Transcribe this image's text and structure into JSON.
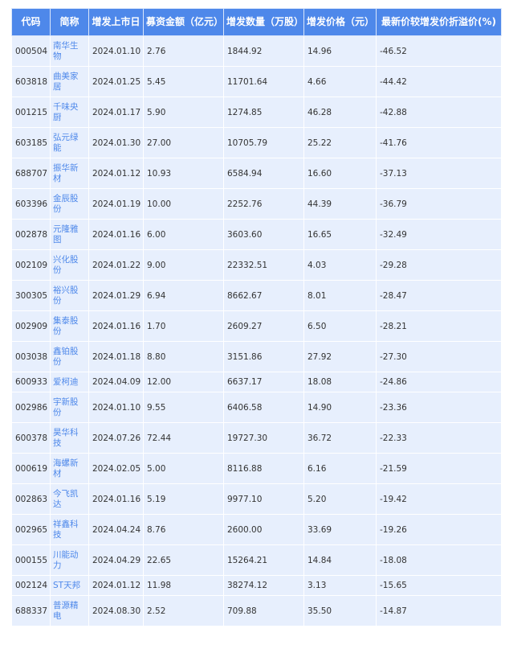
{
  "table": {
    "headers": [
      "代码",
      "简称",
      "增发上市日",
      "募资金额（亿元）",
      "增发数量（万股）",
      "增发价格（元）",
      "最新价较增发价折溢价(%)"
    ],
    "rows": [
      {
        "code": "000504",
        "name": "南华生物",
        "date": "2024.01.10",
        "amount": "2.76",
        "shares": "1844.92",
        "price": "14.96",
        "premium": "-46.52"
      },
      {
        "code": "603818",
        "name": "曲美家居",
        "date": "2024.01.25",
        "amount": "5.45",
        "shares": "11701.64",
        "price": "4.66",
        "premium": "-44.42"
      },
      {
        "code": "001215",
        "name": "千味央厨",
        "date": "2024.01.17",
        "amount": "5.90",
        "shares": "1274.85",
        "price": "46.28",
        "premium": "-42.88"
      },
      {
        "code": "603185",
        "name": "弘元绿能",
        "date": "2024.01.30",
        "amount": "27.00",
        "shares": "10705.79",
        "price": "25.22",
        "premium": "-41.76"
      },
      {
        "code": "688707",
        "name": "振华新材",
        "date": "2024.01.12",
        "amount": "10.93",
        "shares": "6584.94",
        "price": "16.60",
        "premium": "-37.13"
      },
      {
        "code": "603396",
        "name": "金辰股份",
        "date": "2024.01.19",
        "amount": "10.00",
        "shares": "2252.76",
        "price": "44.39",
        "premium": "-36.79"
      },
      {
        "code": "002878",
        "name": "元隆雅图",
        "date": "2024.01.16",
        "amount": "6.00",
        "shares": "3603.60",
        "price": "16.65",
        "premium": "-32.49"
      },
      {
        "code": "002109",
        "name": "兴化股份",
        "date": "2024.01.22",
        "amount": "9.00",
        "shares": "22332.51",
        "price": "4.03",
        "premium": "-29.28"
      },
      {
        "code": "300305",
        "name": "裕兴股份",
        "date": "2024.01.29",
        "amount": "6.94",
        "shares": "8662.67",
        "price": "8.01",
        "premium": "-28.47"
      },
      {
        "code": "002909",
        "name": "集泰股份",
        "date": "2024.01.16",
        "amount": "1.70",
        "shares": "2609.27",
        "price": "6.50",
        "premium": "-28.21"
      },
      {
        "code": "003038",
        "name": "鑫铂股份",
        "date": "2024.01.18",
        "amount": "8.80",
        "shares": "3151.86",
        "price": "27.92",
        "premium": "-27.30"
      },
      {
        "code": "600933",
        "name": "爱柯迪",
        "date": "2024.04.09",
        "amount": "12.00",
        "shares": "6637.17",
        "price": "18.08",
        "premium": "-24.86"
      },
      {
        "code": "002986",
        "name": "宇新股份",
        "date": "2024.01.10",
        "amount": "9.55",
        "shares": "6406.58",
        "price": "14.90",
        "premium": "-23.36"
      },
      {
        "code": "600378",
        "name": "昊华科技",
        "date": "2024.07.26",
        "amount": "72.44",
        "shares": "19727.30",
        "price": "36.72",
        "premium": "-22.33"
      },
      {
        "code": "000619",
        "name": "海螺新材",
        "date": "2024.02.05",
        "amount": "5.00",
        "shares": "8116.88",
        "price": "6.16",
        "premium": "-21.59"
      },
      {
        "code": "002863",
        "name": "今飞凯达",
        "date": "2024.01.16",
        "amount": "5.19",
        "shares": "9977.10",
        "price": "5.20",
        "premium": "-19.42"
      },
      {
        "code": "002965",
        "name": "祥鑫科技",
        "date": "2024.04.24",
        "amount": "8.76",
        "shares": "2600.00",
        "price": "33.69",
        "premium": "-19.26"
      },
      {
        "code": "000155",
        "name": "川能动力",
        "date": "2024.04.29",
        "amount": "22.65",
        "shares": "15264.21",
        "price": "14.84",
        "premium": "-18.08"
      },
      {
        "code": "002124",
        "name": "ST天邦",
        "date": "2024.01.12",
        "amount": "11.98",
        "shares": "38274.12",
        "price": "3.13",
        "premium": "-15.65"
      },
      {
        "code": "688337",
        "name": "普源精电",
        "date": "2024.08.30",
        "amount": "2.52",
        "shares": "709.88",
        "price": "35.50",
        "premium": "-14.87"
      }
    ]
  }
}
